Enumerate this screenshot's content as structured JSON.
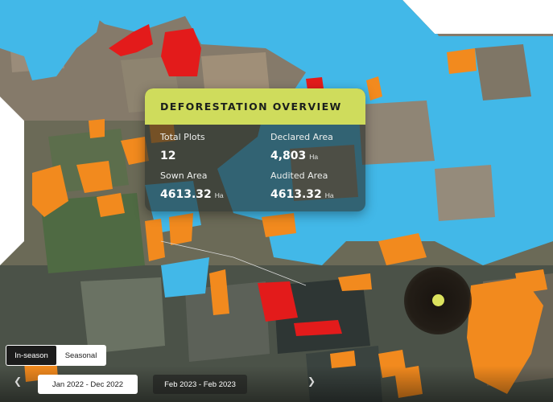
{
  "overview": {
    "title": "DEFORESTATION OVERVIEW",
    "stats": [
      {
        "label": "Total Plots",
        "value": "12",
        "unit": ""
      },
      {
        "label": "Declared Area",
        "value": "4,803",
        "unit": "Ha"
      },
      {
        "label": "Sown Area",
        "value": "4613.32",
        "unit": "Ha"
      },
      {
        "label": "Audited Area",
        "value": "4613.32",
        "unit": "Ha"
      }
    ]
  },
  "season_toggle": {
    "options": [
      "In-season",
      "Seasonal"
    ],
    "selected": "In-season"
  },
  "timeline": {
    "ranges": [
      "Jan 2022 - Dec 2022",
      "Feb 2023 - Feb 2023"
    ],
    "selected": "Jan 2022 - Dec 2022",
    "prev_icon": "chevron-left-icon",
    "next_icon": "chevron-right-icon"
  },
  "colors": {
    "water": "#42b8e8",
    "deforestation": "#e31b1b",
    "degradation": "#f28a1e",
    "accent": "#cfdc5c"
  }
}
